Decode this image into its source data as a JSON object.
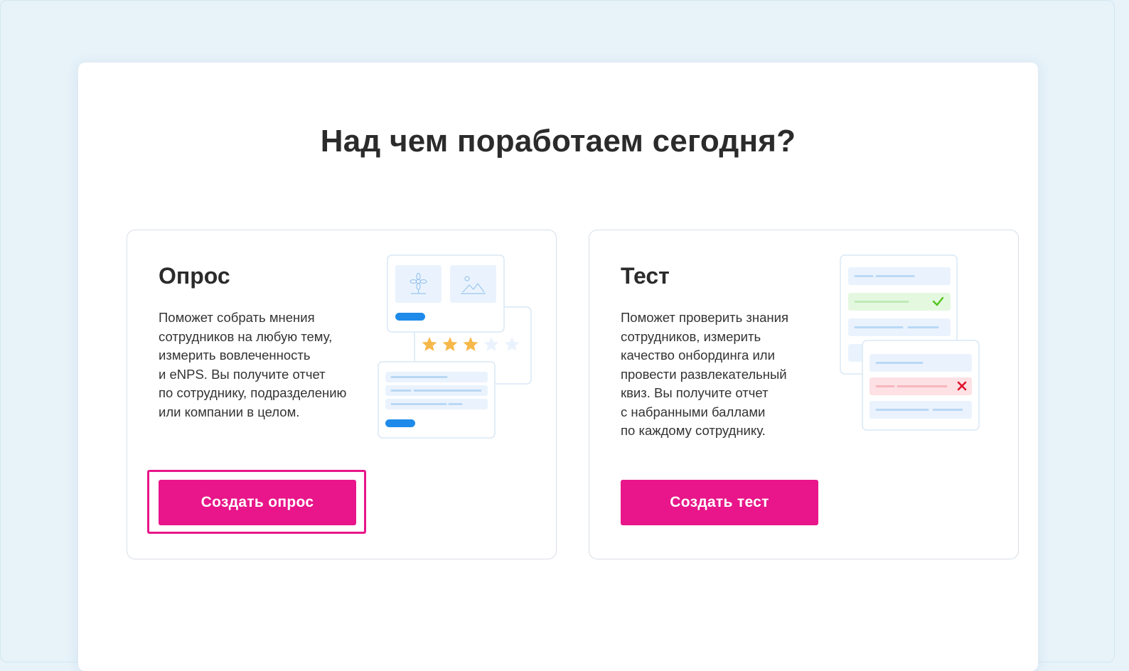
{
  "heading": "Над чем поработаем сегодня?",
  "cards": [
    {
      "title": "Опрос",
      "description": "Поможет собрать мнения\nсотрудников на любую тему,\nизмерить вовлеченность\nи eNPS. Вы получите отчет\nпо сотруднику, подразделению\nили компании в целом.",
      "button": "Создать опрос",
      "selected": true,
      "rating_shown": 3,
      "rating_max": 5
    },
    {
      "title": "Тест",
      "description": "Поможет проверить знания\nсотрудников, измерить\nкачество онбординга или\nпровести развлекательный\nквиз. Вы получите отчет\nс набранными баллами\nпо каждому сотруднику.",
      "button": "Создать тест",
      "selected": false
    }
  ],
  "colors": {
    "accent": "#e8168a",
    "background": "#e7f2f9",
    "star": "#f7b84b",
    "check": "#52c41a",
    "cross": "#e0102b"
  }
}
